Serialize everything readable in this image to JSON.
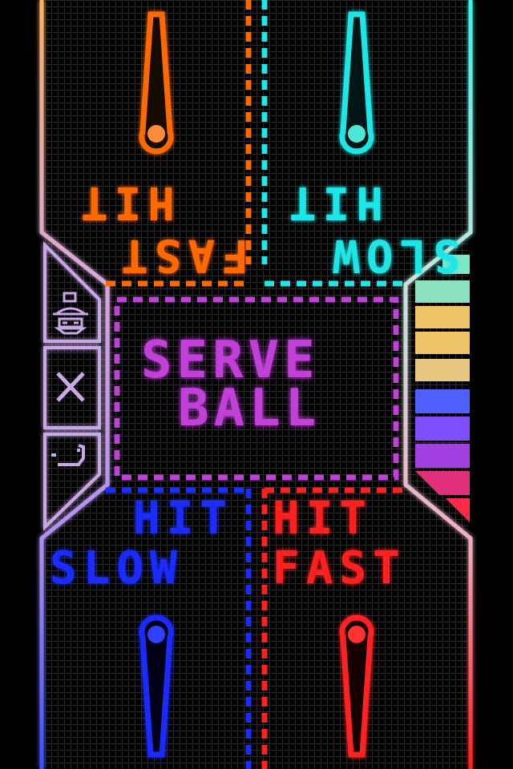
{
  "top_left_zone": {
    "line1": "FAST",
    "line2": "HIT",
    "color": "#ff6a00"
  },
  "top_right_zone": {
    "line1": "SLOW",
    "line2": "HIT",
    "color": "#1ee6e6"
  },
  "bottom_left_zone": {
    "line1": "HIT",
    "line2": "SLOW",
    "color": "#1a2cff"
  },
  "bottom_right_zone": {
    "line1": "HIT",
    "line2": "FAST",
    "color": "#ff2020"
  },
  "center_message": {
    "line1": "SERVE",
    "line2": "BALL",
    "color": "#c040d8"
  },
  "left_menu": [
    {
      "icon": "robot-icon"
    },
    {
      "icon": "close-icon"
    },
    {
      "icon": "help-icon"
    }
  ],
  "colors": {
    "frame_purple": "#c9a8e6",
    "grid": "#2a2a2a",
    "meter_colors": [
      "#6fe8c8",
      "#f2c46a",
      "#5060ff",
      "#ff2a4a"
    ]
  }
}
